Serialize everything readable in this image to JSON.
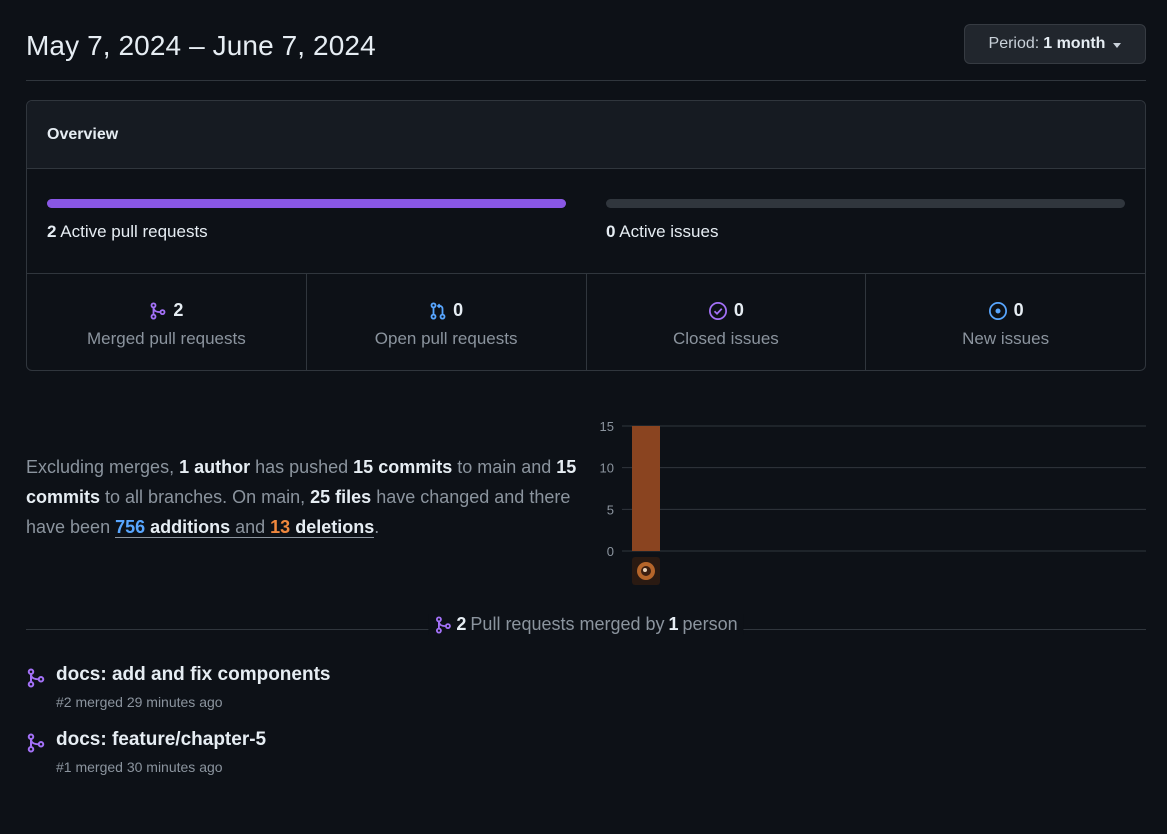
{
  "header": {
    "date_range": "May 7, 2024 – June 7, 2024",
    "period_label": "Period:",
    "period_value": "1 month"
  },
  "overview": {
    "title": "Overview",
    "active_prs": {
      "count": "2",
      "label": "Active pull requests",
      "fill_fraction": 1.0
    },
    "active_issues": {
      "count": "0",
      "label": "Active issues",
      "fill_fraction": 0.0
    },
    "stats": [
      {
        "icon": "merged-icon",
        "value": "2",
        "label": "Merged pull requests",
        "color": "#a371f7"
      },
      {
        "icon": "pull-request-icon",
        "value": "0",
        "label": "Open pull requests",
        "color": "#58a6ff"
      },
      {
        "icon": "check-circle-icon",
        "value": "0",
        "label": "Closed issues",
        "color": "#a371f7"
      },
      {
        "icon": "issue-opened-icon",
        "value": "0",
        "label": "New issues",
        "color": "#58a6ff"
      }
    ]
  },
  "summary": {
    "p1": "Excluding merges, ",
    "authors": "1 author",
    "p2": " has pushed ",
    "commits_main": "15 commits",
    "p3": " to main and ",
    "commits_all": "15 commits",
    "p4": " to all branches. On main, ",
    "files": "25 files",
    "p5": " have changed and there have been ",
    "additions_num": "756",
    "additions_word": " additions",
    "p6": " and ",
    "deletions_num": "13",
    "deletions_word": " deletions",
    "p7": "."
  },
  "chart_data": {
    "type": "bar",
    "categories": [
      "contributor-1"
    ],
    "values": [
      15
    ],
    "ylim": [
      0,
      15
    ],
    "yticks": [
      "0",
      "5",
      "10",
      "15"
    ],
    "bar_color": "#8a4420",
    "grid": true
  },
  "merged_section": {
    "count": "2",
    "p1": " Pull requests merged by ",
    "people": "1",
    "p2": " person"
  },
  "pull_requests": [
    {
      "title": "docs: add and fix components",
      "meta": "#2 merged 29 minutes ago"
    },
    {
      "title": "docs: feature/chapter-5",
      "meta": "#1 merged 30 minutes ago"
    }
  ],
  "colors": {
    "accent_purple": "#8957e5",
    "link_blue": "#58a6ff",
    "deletion_orange": "#f0883e"
  }
}
